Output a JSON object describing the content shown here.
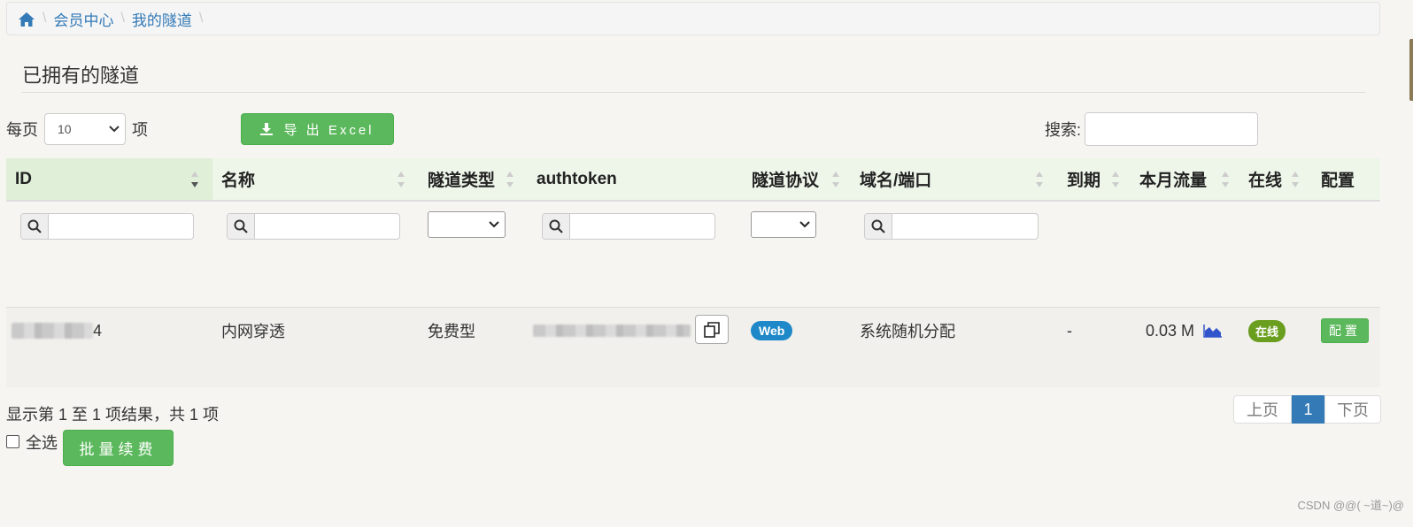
{
  "breadcrumb": {
    "items": [
      "会员中心",
      "我的隧道"
    ]
  },
  "page_title": "已拥有的隧道",
  "length": {
    "prefix": "每页",
    "value": "10",
    "suffix": "项"
  },
  "export_label": "导 出 Excel",
  "search": {
    "label": "搜索:",
    "value": ""
  },
  "columns": [
    "ID",
    "名称",
    "隧道类型",
    "authtoken",
    "隧道协议",
    "域名/端口",
    "到期",
    "本月流量",
    "在线",
    "配置"
  ],
  "rows": [
    {
      "id_suffix": "4",
      "name": "内网穿透",
      "type": "免费型",
      "protocol": "Web",
      "domain": "系统随机分配",
      "expire": "-",
      "traffic": "0.03 M",
      "online": "在线",
      "config": "配置"
    }
  ],
  "info_text": "显示第 1 至 1 项结果，共 1 项",
  "pager": {
    "prev": "上页",
    "current": "1",
    "next": "下页"
  },
  "select_all_label": "全选",
  "bulk_renew_label": "批量续费",
  "watermark": "CSDN @@( ~道~)@",
  "colors": {
    "accent": "#337ab7",
    "success": "#5cb85c",
    "web_badge": "#1e88c8",
    "online_badge": "#6a9e1f"
  }
}
